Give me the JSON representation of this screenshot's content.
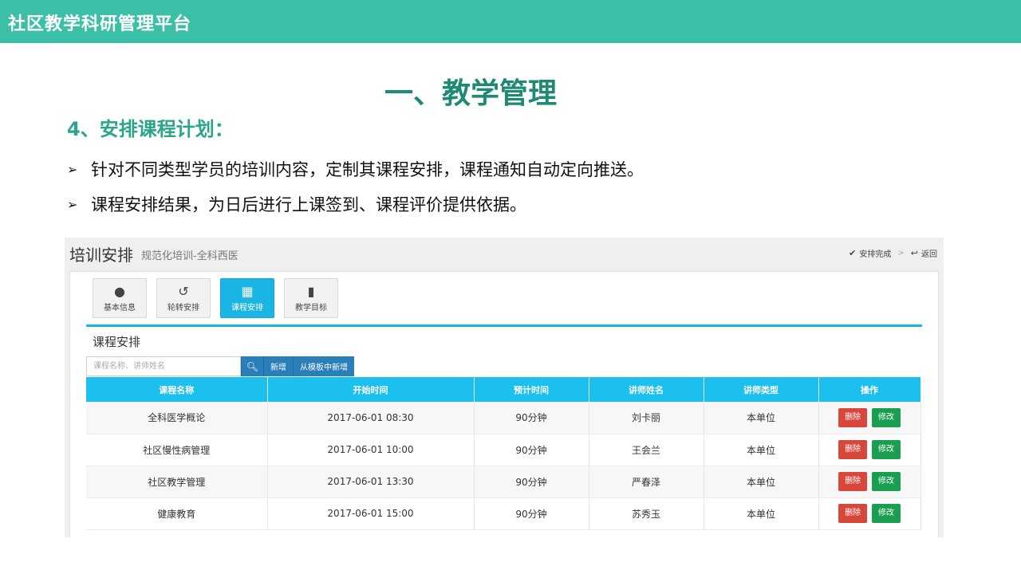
{
  "header": {
    "title": "社区教学科研管理平台"
  },
  "slide": {
    "heading": "一、教学管理",
    "section_title": "4、安排课程计划：",
    "bullets": [
      "针对不同类型学员的培训内容，定制其课程安排，课程通知自动定向推送。",
      "课程安排结果，为日后进行上课签到、课程评价提供依据。"
    ]
  },
  "app": {
    "title": "培训安排",
    "subtitle": "规范化培训-全科西医",
    "actions": {
      "done": "安排完成",
      "back": "返回"
    },
    "tabs": [
      {
        "label": "基本信息",
        "icon": "user-icon"
      },
      {
        "label": "轮转安排",
        "icon": "history-icon"
      },
      {
        "label": "课程安排",
        "icon": "building-icon"
      },
      {
        "label": "教学目标",
        "icon": "book-icon"
      }
    ],
    "active_tab": "课程安排",
    "panel": {
      "title": "课程安排",
      "search_placeholder": "课程名称、讲师姓名",
      "add_label": "新增",
      "add_from_template_label": "从模板中新增"
    },
    "table": {
      "columns": [
        "课程名称",
        "开始时间",
        "预计时间",
        "讲师姓名",
        "讲师类型",
        "操作"
      ],
      "rows": [
        {
          "name": "全科医学概论",
          "start": "2017-06-01 08:30",
          "duration": "90分钟",
          "teacher": "刘卡丽",
          "type": "本单位"
        },
        {
          "name": "社区慢性病管理",
          "start": "2017-06-01 10:00",
          "duration": "90分钟",
          "teacher": "王会兰",
          "type": "本单位"
        },
        {
          "name": "社区教学管理",
          "start": "2017-06-01 13:30",
          "duration": "90分钟",
          "teacher": "严春泽",
          "type": "本单位"
        },
        {
          "name": "健康教育",
          "start": "2017-06-01 15:00",
          "duration": "90分钟",
          "teacher": "苏秀玉",
          "type": "本单位"
        }
      ],
      "delete_label": "删除",
      "edit_label": "修改"
    }
  },
  "colors": {
    "brand": "#3bbfa7",
    "heading": "#1f8a73",
    "accent": "#1ab5e4",
    "delete": "#d9463b",
    "edit": "#1a9e4f"
  }
}
